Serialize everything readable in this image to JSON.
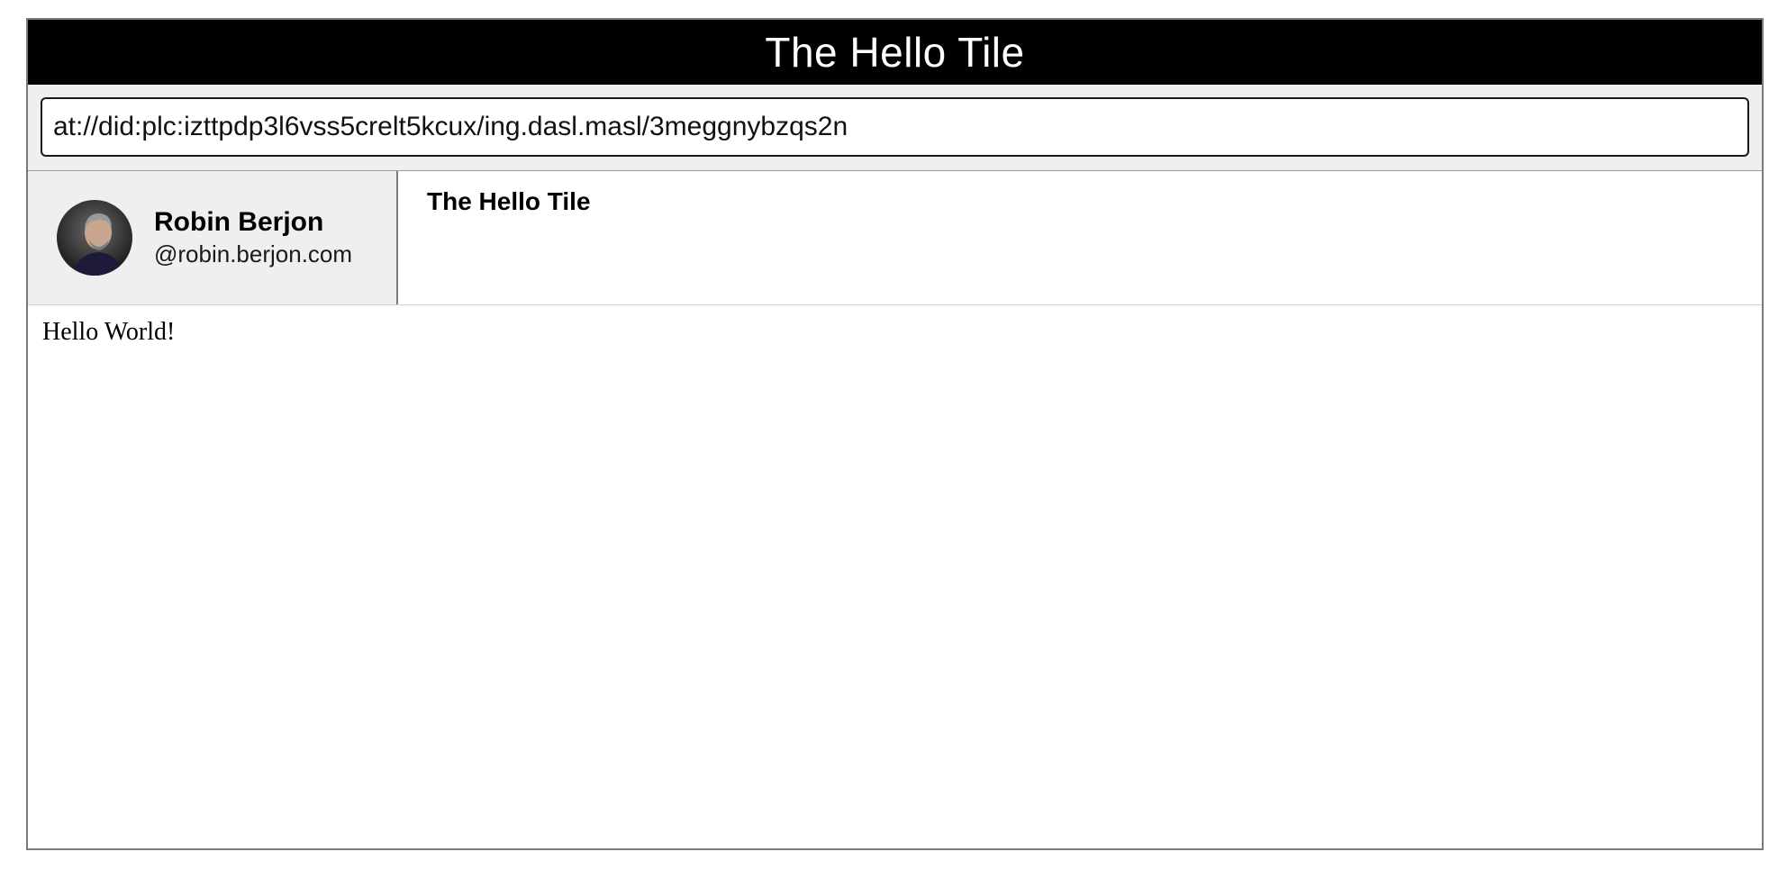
{
  "header": {
    "title": "The Hello Tile"
  },
  "address_bar": {
    "value": "at://did:plc:izttpdp3l6vss5crelt5kcux/ing.dasl.masl/3meggnybzqs2n"
  },
  "author": {
    "name": "Robin Berjon",
    "handle": "@robin.berjon.com",
    "avatar_icon": "user-photo"
  },
  "tile": {
    "name": "The Hello Tile"
  },
  "content": {
    "text": "Hello World!"
  }
}
